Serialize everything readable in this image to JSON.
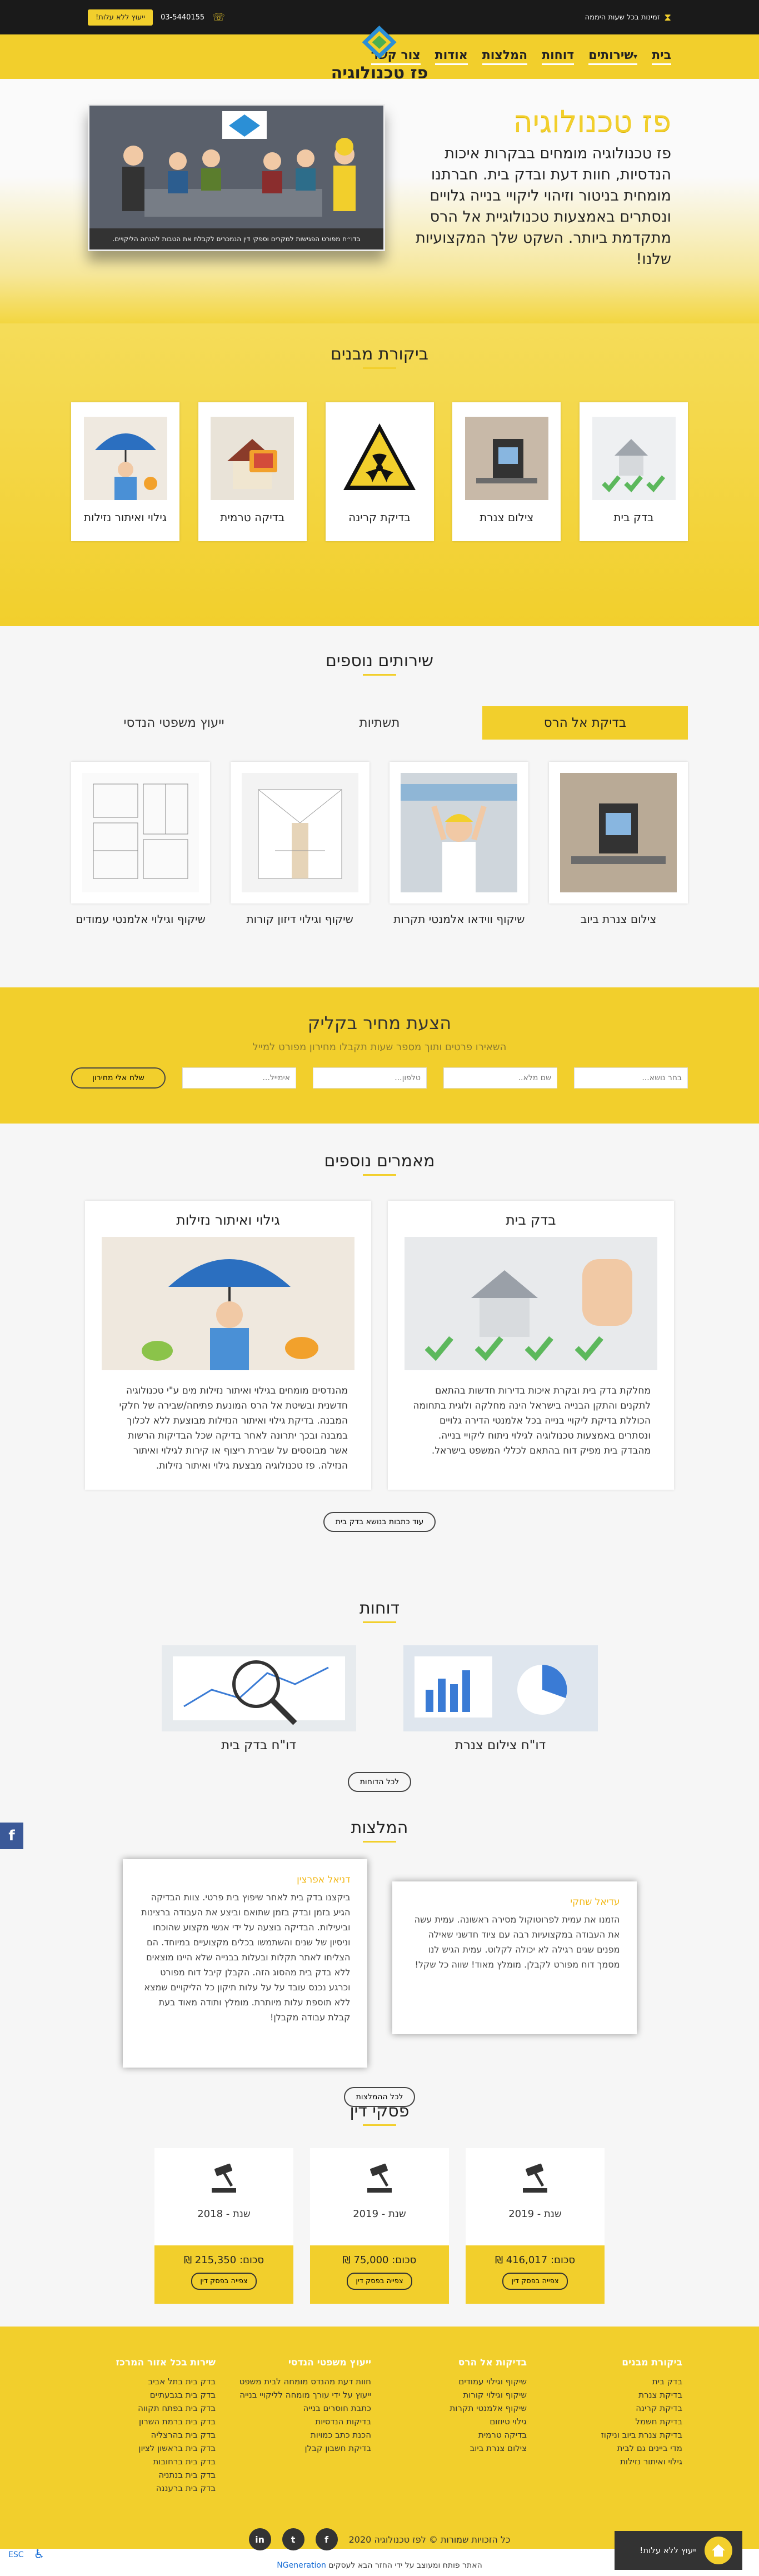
{
  "topbar": {
    "promo": "זמינות בכל שעות היממה",
    "phone": "03-5440155",
    "cta": "ייעוץ ללא עלות!"
  },
  "nav": {
    "items": [
      "בית",
      "שירותים",
      "דוחות",
      "המלצות",
      "אודות",
      "צור קשר"
    ],
    "logo_text": "פז טכנולוגיה"
  },
  "hero": {
    "title": "פז טכנולוגיה",
    "text": "פז טכנולוגיה מומחים בבקרות איכות הנדסיות, חוות דעת ובדק בית. חברתנו מומחית בניטור וזיהוי ליקויי בנייה גלויים ונסתרים באמצעות טכנולוגיית אל הרס מתקדמת ביותר. השקט שלך המקצועיות שלנו!",
    "caption": "בדו״ח מפורט הפגישות למקרים וספקי דין הנמכרים לקבלת את הטבות להנחה הליקויים."
  },
  "inspections": {
    "title": "ביקורת מבנים",
    "items": [
      "בדק בית",
      "צילום צנרת",
      "בדיקת קרינה",
      "בדיקה טרמית",
      "גילוי ואיתור נזילות"
    ]
  },
  "services": {
    "title": "שירותים נוספים",
    "tabs": [
      "בדיקת אל הרס",
      "תשתיות",
      "ייעוץ משפטי הנדסי"
    ],
    "cards": [
      "צילום צנרת ביוב",
      "שיקוף ווידאו אלמנטי תקרות",
      "שיקוף וגילוי דיזון קורות",
      "שיקוף וגילוי אלמנטי עמודים"
    ]
  },
  "quote": {
    "title": "הצעת מחיר בקליק",
    "subtitle": "השאירו פרטים ותוך מספר שעות תקבלו מחירון מפורט למייל",
    "select_placeholder": "בחר נושא...",
    "name_placeholder": "שם מלא..",
    "phone_placeholder": "טלפון...",
    "email_placeholder": "אימייל...",
    "button": "שלח אלי מחירון"
  },
  "articles": {
    "title": "מאמרים נוספים",
    "items": [
      {
        "title": "בדק בית",
        "text": "מחלקת בדק בית ובקרת איכות בדירות חדשות בהתאם לתקנים והתקן הבנייה בישראל הינה מחלקה ולוגית בתחומה הכוללת בדיקת ליקויי בנייה בכל אלמנטי הדירה גלויים ונסתרים באמצעות טכנולוגיה לגילוי ניתוח ליקויי בנייה. מהבדק בית מפיק דוח בהתאם לכללי המשפט בישראל."
      },
      {
        "title": "גילוי ואיתור נזילות",
        "text": "מהנדסים מומחים בגילוי ואיתור נזילות מים ע\"י טכנולוגיה חדשנית ובשיטת אל הרס המונעת פתיחה/שבירה של חלקי המבנה. בדיקת גילוי ואיתור הנזילות מבוצעת ללא לכלוך במבנה ובכך יתרונה לאחר בדיקה שכל הבדיקות הרשות אשר מבוססים על שבירת ריצוף או קירות לגילוי ואיתור הנזילה. פז טכנולוגיה מבצעת גילוי ואיתור נזילות."
      }
    ],
    "more_button": "עוד כתבות בנושא בדק בית"
  },
  "reports": {
    "title": "דוחות",
    "items": [
      "דו\"ח צילום צנרת",
      "דו\"ח בדק בית"
    ],
    "button": "לכל הדוחות"
  },
  "recommendations": {
    "title": "המלצות",
    "items": [
      {
        "name": "עדיאל שחקי",
        "text": "הזמנו את עמית לפרוטוקול מסירה ראשונה. עמית עשה את העבודה במקצועיות רבה עם ציוד חדשני שאילה מפנים שגים רגילה לא יכולה לקלוט. עמית הגיש לנו מסמך דוח מפורט לקבלן. מומלץ מאוד! שווה כל שקל!"
      },
      {
        "name": "דניאל אפרצין",
        "text": "ביקצנו בדק בית לאחר שיפוץ בית פרטי. צוות הבדיקה הגיע בזמן ובדק בזמן שתואם וביצע את העבודה ברצינות וביעילות. הבדיקה בוצעה על ידי אנשי מקצוע שהוכחו וניסיון של שנים והשתמשו בכלים מקצועיים במיוחד. הם הצליחו לאתר תקלות ובעלות בבנייה שלא היינו מוצאים ללא בדק בית מהסוג הזה. הקבלן קיבל דוח מפורט וכרגע נכנס עובד על על עלות תיקון כל הליקויים שמצא ללא תוספת עלות מיותרת. מומלץ ותודה מאוד בעת קבלת עבודה מקבלן!"
      }
    ],
    "button": "לכל ההמלצות"
  },
  "rulings": {
    "title": "פסקי דין",
    "items": [
      {
        "year": "שנת - 2019",
        "sum": "סכום: 416,017 ₪",
        "button": "צפייה בפסק דין"
      },
      {
        "year": "שנת - 2019",
        "sum": "סכום: 75,000 ₪",
        "button": "צפייה בפסק דין"
      },
      {
        "year": "שנת - 2018",
        "sum": "סכום: 215,350 ₪",
        "button": "צפייה בפסק דין"
      }
    ]
  },
  "footer": {
    "cols": [
      {
        "title": "ביקורת מבנים",
        "links": [
          "בדק בית",
          "בדיקת צנרת",
          "בדיקת קרינה",
          "בדיקת חשמל",
          "בדיקת צנרת ביוב וניקוז",
          "מדי ביינים גם לבית",
          "גילוי ואיתור נזילות"
        ]
      },
      {
        "title": "בדיקות אל הרס",
        "links": [
          "שיקוף וגילוי עמודים",
          "שיקוף וגילוי קורות",
          "שיקוף אלמנטי תקרות",
          "גילוי טיוזום",
          "בדיקה טרמית",
          "צילום צנרת ביוב"
        ]
      },
      {
        "title": "ייעוץ משפטי הנדסי",
        "links": [
          "חוות דעת מהנדס מומחה לבית משפט",
          "ייעוץ על ידי עורך מומחה לליקויי בנייה",
          "כתבת חוסרים בנייה",
          "בדיקות הנדסיות",
          "הכנת כתב כמויות",
          "בדיקת חשבון קבלן"
        ]
      },
      {
        "title": "שירות בכל אזור המרכז",
        "links": [
          "בדק בית בתל אביב",
          "בדק בית בגבעתיים",
          "בדק בית בפתח תקווה",
          "בדק בית ברמת השרון",
          "בדק בית בהרצליה",
          "בדק בית בראשון לציון",
          "בדק בית ברחובות",
          "בדק בית בנתניה",
          "בדק בית ברעננה"
        ]
      }
    ],
    "copyright": "כל הזכויות שמורות © לפז טכנולוגיה 2020",
    "social": [
      "f",
      "t",
      "in"
    ]
  },
  "credit": {
    "text": "האתר פותח ומעוצב על ידי החזר הבא לעסקים",
    "brand": "NGeneration"
  },
  "widgets": {
    "whatsapp": "ייעוץ ללא עלות!",
    "facebook": "f",
    "esc": "ESC"
  },
  "colors": {
    "accent": "#f2cf2c",
    "dark": "#1a1a1a"
  }
}
